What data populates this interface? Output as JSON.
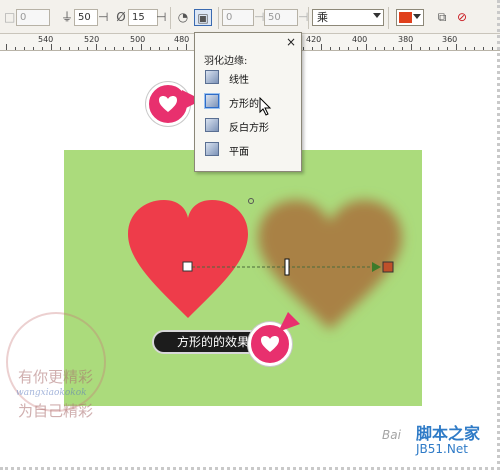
{
  "toolbar": {
    "field1_value": "0",
    "field2_value": "50",
    "field3_value": "15",
    "field4_value": "0",
    "field5_value": "50",
    "mode_combo": "乘",
    "fill_color": "#e0401c"
  },
  "ruler": {
    "labels": [
      "540",
      "520",
      "500",
      "480",
      "420",
      "400",
      "380",
      "360"
    ]
  },
  "dropdown": {
    "title": "羽化边缘:",
    "close": "×",
    "items": [
      {
        "label": "线性"
      },
      {
        "label": "方形的"
      },
      {
        "label": "反白方形"
      },
      {
        "label": "平面"
      }
    ]
  },
  "canvas": {
    "background": "#abdb7c",
    "heart_left_color": "#ee3c4a",
    "heart_right_color": "#a98145"
  },
  "callout": {
    "text": "方形的的效果"
  },
  "watermark": {
    "line1": "有你更精彩",
    "line2": "wangxiaokokok",
    "line3": "为自己精彩"
  },
  "footer": {
    "baidu": "Bai",
    "site": "脚本之家",
    "site_url": "JB51.Net"
  }
}
